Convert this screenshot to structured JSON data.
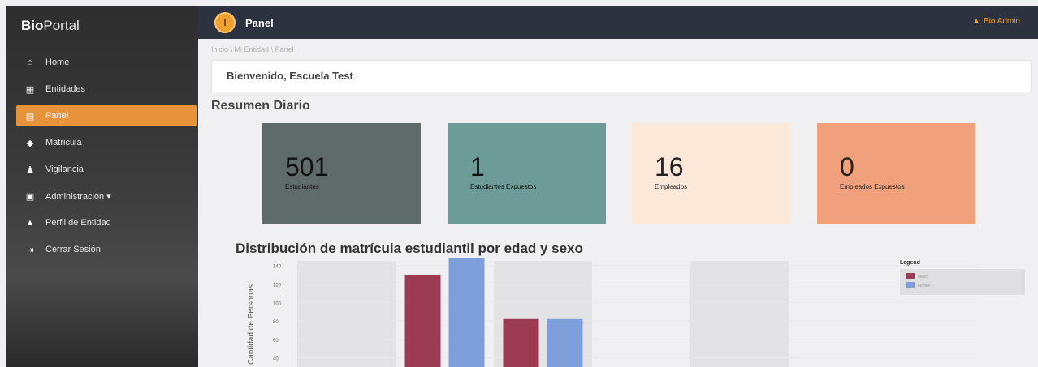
{
  "brand": {
    "bold": "Bio",
    "rest": "Portal"
  },
  "sidebar": {
    "items": [
      {
        "label": "Home",
        "icon": "home-icon",
        "glyph": "⌂"
      },
      {
        "label": "Entidades",
        "icon": "building-icon",
        "glyph": "▦"
      },
      {
        "label": "Panel",
        "icon": "panel-icon",
        "glyph": "▤",
        "active": true
      },
      {
        "label": "Matricula",
        "icon": "graduation-cap-icon",
        "glyph": "◆"
      },
      {
        "label": "Vigilancia",
        "icon": "users-icon",
        "glyph": "♟"
      },
      {
        "label": "Administración ▾",
        "icon": "admin-icon",
        "glyph": "▣"
      },
      {
        "label": "Perfil de Entidad",
        "icon": "profile-icon",
        "glyph": "▲"
      },
      {
        "label": "Cerrar Sesión",
        "icon": "logout-icon",
        "glyph": "⇥"
      }
    ]
  },
  "topbar": {
    "logo_text": "I",
    "title": "Panel",
    "user": "Bio Admin"
  },
  "breadcrumb": "Inicio \\ Mi Entidad \\ Panel",
  "welcome": "Bienvenido, Escuela Test",
  "summary_title": "Resumen Diario",
  "cards": [
    {
      "value": "501",
      "label": "Estudiantes",
      "color": "#5f6b69"
    },
    {
      "value": "1",
      "label": "Estudiantes Expuestos",
      "color": "#6d9c98"
    },
    {
      "value": "16",
      "label": "Empleados",
      "color": "#fce8d9"
    },
    {
      "value": "0",
      "label": "Empleados Expuestos",
      "color": "#f0a07a"
    }
  ],
  "chart_title": "Distribución de matrícula estudiantil por edad y sexo",
  "chart_data": {
    "type": "bar",
    "ylabel": "Cantidad de Personas",
    "ylim": [
      30,
      145
    ],
    "yticks": [
      40,
      60,
      80,
      100,
      120,
      140
    ],
    "legend_title": "Legend",
    "legend_position": "top-right",
    "series": [
      {
        "name": "Masc",
        "color": "#9c3a52",
        "values": [
          null,
          130,
          82,
          null
        ]
      },
      {
        "name": "Femen",
        "color": "#7f9fdc",
        "values": [
          null,
          148,
          82,
          null
        ]
      }
    ],
    "shaded_bands": [
      0,
      2,
      4
    ]
  }
}
